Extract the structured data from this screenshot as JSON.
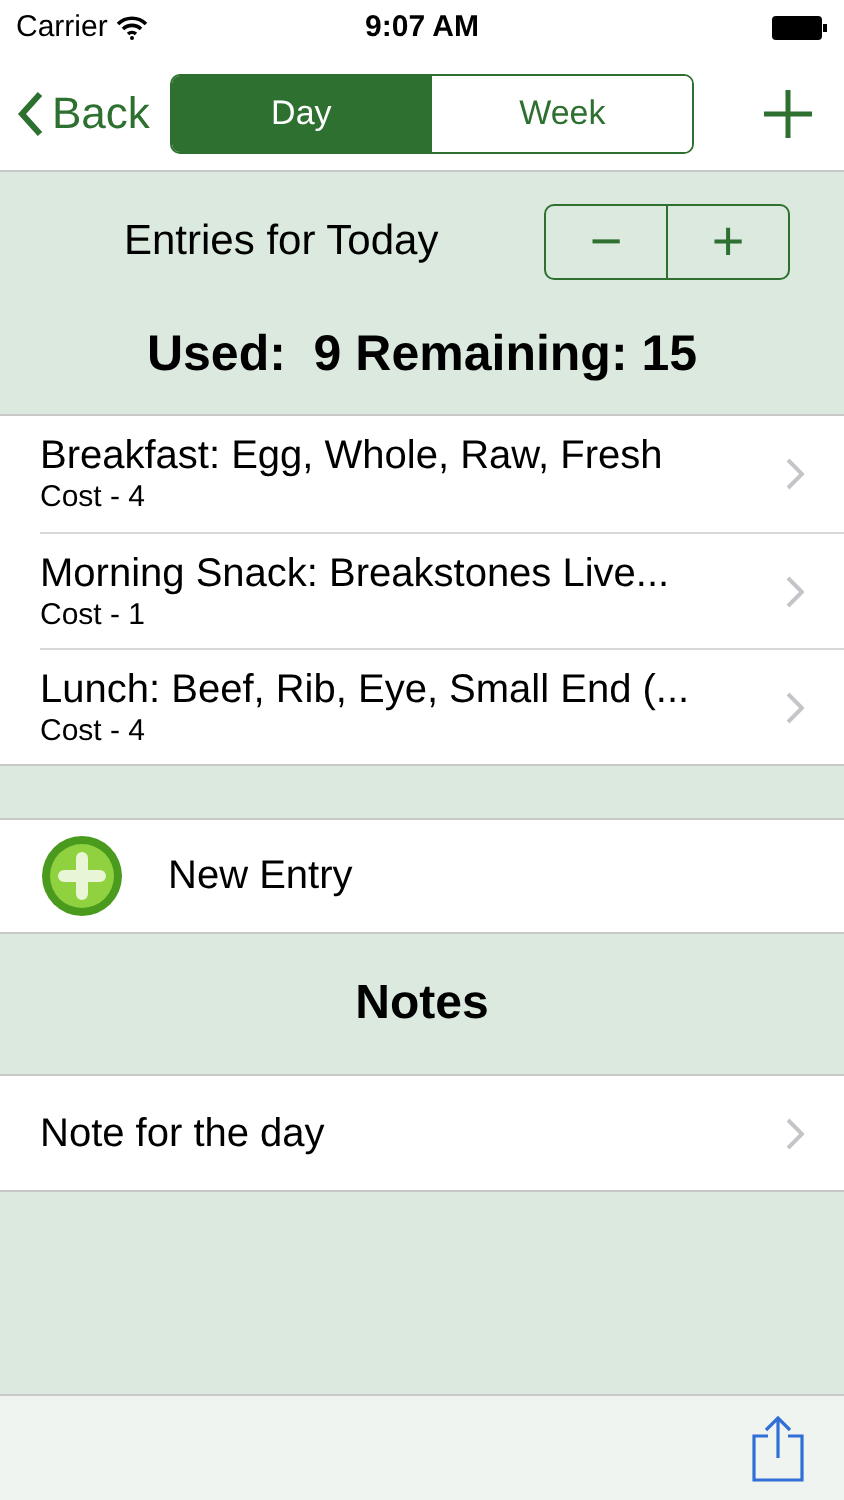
{
  "status_bar": {
    "carrier": "Carrier",
    "time": "9:07 AM"
  },
  "nav": {
    "back": "Back",
    "segments": [
      {
        "label": "Day",
        "selected": true
      },
      {
        "label": "Week",
        "selected": false
      }
    ]
  },
  "header": {
    "title": "Entries for Today",
    "stepper": [
      "−",
      "+"
    ],
    "summary": "Used:  9 Remaining: 15"
  },
  "entries": [
    {
      "title": "Breakfast: Egg, Whole, Raw, Fresh",
      "subtitle": "Cost - 4"
    },
    {
      "title": "Morning Snack: Breakstones Live...",
      "subtitle": "Cost - 1"
    },
    {
      "title": "Lunch: Beef, Rib, Eye, Small End (...",
      "subtitle": "Cost - 4"
    }
  ],
  "new_entry": "New Entry",
  "notes": {
    "title": "Notes",
    "items": [
      "Note for the day"
    ]
  }
}
